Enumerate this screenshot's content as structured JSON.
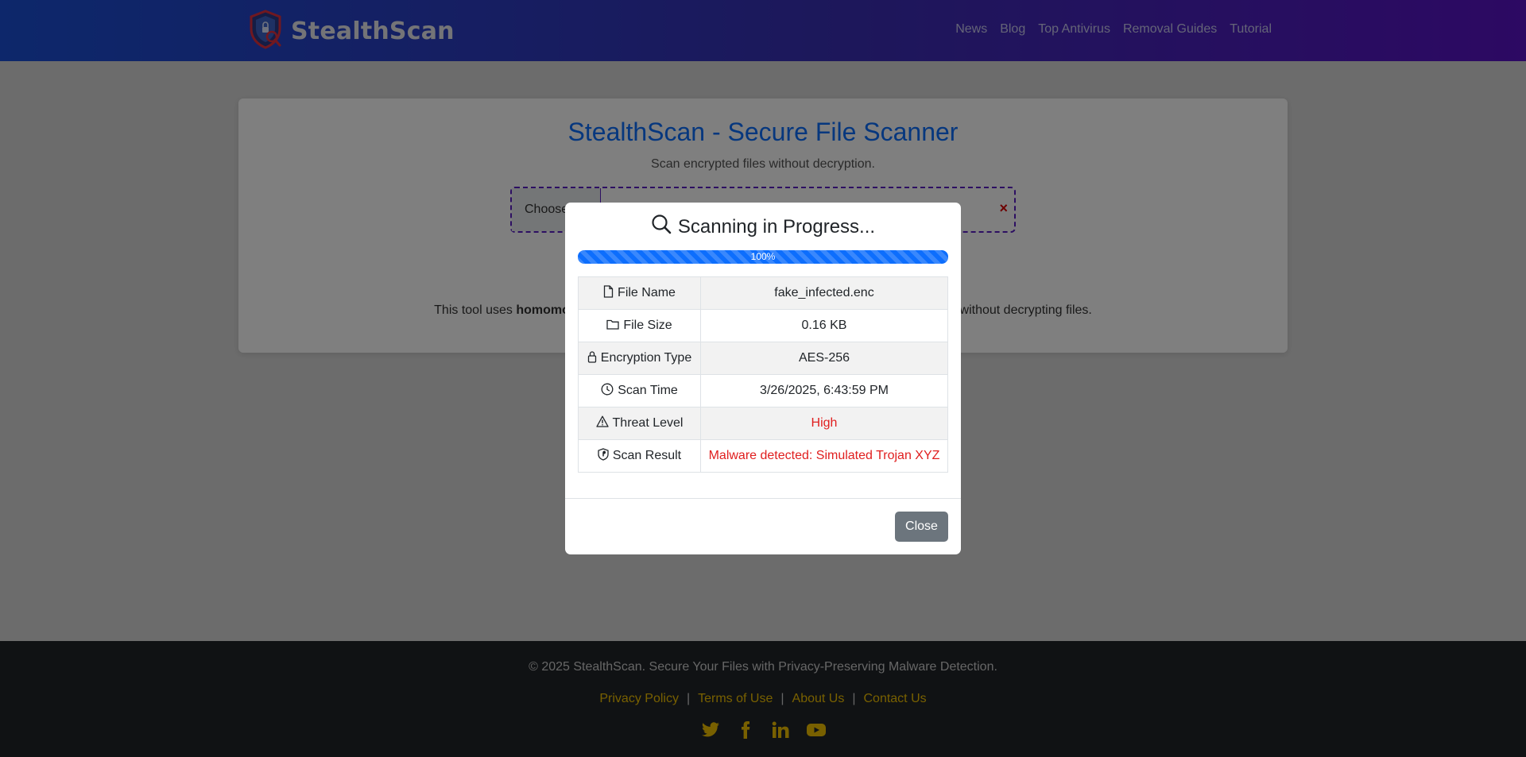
{
  "header": {
    "brand": "StealthScan",
    "nav": [
      "News",
      "Blog",
      "Top Antivirus",
      "Removal Guides",
      "Tutorial"
    ]
  },
  "main": {
    "title": "StealthScan - Secure File Scanner",
    "subtitle": "Scan encrypted files without decryption.",
    "choose_label": "Choose",
    "clear_icon": "×",
    "info_prefix": "This tool uses ",
    "info_bold": "homomorp",
    "info_suffix": "re without decrypting files."
  },
  "modal": {
    "title": "Scanning in Progress...",
    "progress_label": "100%",
    "progress_value": 1.0,
    "rows": [
      {
        "label": "File Name",
        "value": "fake_infected.enc",
        "icon": "file-icon"
      },
      {
        "label": "File Size",
        "value": "0.16 KB",
        "icon": "folder-icon"
      },
      {
        "label": "Encryption Type",
        "value": "AES-256",
        "icon": "lock-icon"
      },
      {
        "label": "Scan Time",
        "value": "3/26/2025, 6:43:59 PM",
        "icon": "clock-icon"
      },
      {
        "label": "Threat Level",
        "value": "High",
        "icon": "warning-icon"
      },
      {
        "label": "Scan Result",
        "value": "Malware detected: Simulated Trojan XYZ",
        "icon": "shield-icon"
      }
    ],
    "close_label": "Close"
  },
  "footer": {
    "copyright": "© 2025 StealthScan. Secure Your Files with Privacy-Preserving Malware Detection.",
    "links": [
      "Privacy Policy",
      "Terms of Use",
      "About Us",
      "Contact Us"
    ],
    "socials": [
      "twitter-icon",
      "facebook-icon",
      "linkedin-icon",
      "youtube-icon"
    ]
  },
  "colors": {
    "accent": "#0d6efd",
    "danger": "#e01e1e",
    "footer_link": "#f0c000"
  }
}
